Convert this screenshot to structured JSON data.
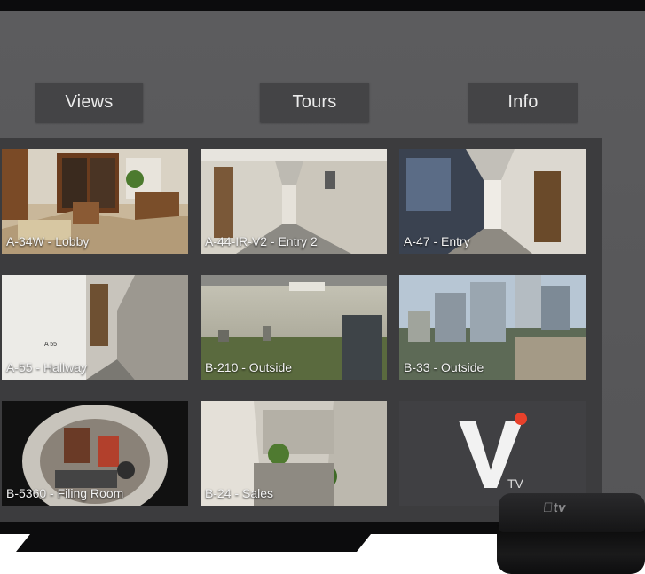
{
  "nav": {
    "views_label": "Views",
    "tours_label": "Tours",
    "info_label": "Info"
  },
  "cameras": [
    {
      "label": "A-34W - Lobby"
    },
    {
      "label": "A-44-IR-V2 - Entry 2"
    },
    {
      "label": "A-47 - Entry"
    },
    {
      "label": "A-55 - Hallway"
    },
    {
      "label": "B-210 - Outside"
    },
    {
      "label": "B-33 - Outside"
    },
    {
      "label": "B-5360 - Filing Room"
    },
    {
      "label": "B-24 - Sales"
    }
  ],
  "logo": {
    "letter": "V",
    "suffix": "TV",
    "accent_color": "#e8412b"
  },
  "device": {
    "brand": "tv",
    "icon": "apple-icon"
  },
  "colors": {
    "screen_bg": "#59595b",
    "button_bg": "#444446",
    "grid_bg": "#3c3c3e"
  }
}
